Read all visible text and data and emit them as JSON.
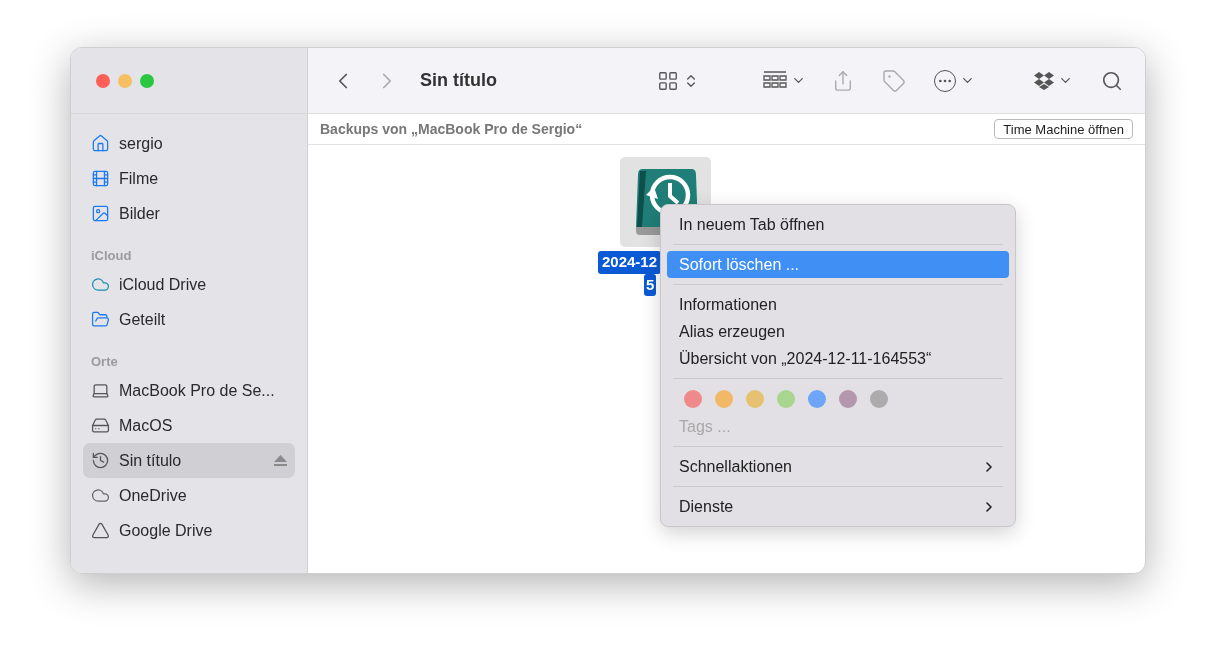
{
  "window": {
    "title": "Sin título"
  },
  "sidebar": {
    "sections": [
      {
        "items": [
          {
            "label": "sergio",
            "kind": "home",
            "selected": false
          },
          {
            "label": "Filme",
            "kind": "film",
            "selected": false
          },
          {
            "label": "Bilder",
            "kind": "photo",
            "selected": false
          }
        ]
      },
      {
        "header": "iCloud",
        "items": [
          {
            "label": "iCloud Drive",
            "kind": "cloud",
            "selected": false
          },
          {
            "label": "Geteilt",
            "kind": "shared",
            "selected": false
          }
        ]
      },
      {
        "header": "Orte",
        "items": [
          {
            "label": "MacBook Pro de Se...",
            "kind": "laptop",
            "selected": false
          },
          {
            "label": "MacOS",
            "kind": "disk",
            "selected": false
          },
          {
            "label": "Sin título",
            "kind": "history",
            "selected": true,
            "eject": true
          },
          {
            "label": "OneDrive",
            "kind": "cloudgray",
            "selected": false
          },
          {
            "label": "Google Drive",
            "kind": "drive",
            "selected": false
          }
        ]
      }
    ]
  },
  "path_bar": {
    "label": "Backups von „MacBook Pro de Sergio“",
    "button": "Time Machine öffnen"
  },
  "file": {
    "name_lines": [
      "2024-12",
      "5"
    ],
    "selected": true
  },
  "context_menu": {
    "groups": [
      [
        {
          "label": "In neuem Tab öffnen",
          "selected": false
        }
      ],
      [
        {
          "label": "Sofort löschen ...",
          "selected": true
        }
      ],
      [
        {
          "label": "Informationen",
          "selected": false
        },
        {
          "label": "Alias erzeugen",
          "selected": false
        },
        {
          "label": "Übersicht von „2024-12-11-164553“",
          "selected": false
        }
      ]
    ],
    "tags": [
      {
        "color": "#f08a8a"
      },
      {
        "color": "#f2b866"
      },
      {
        "color": "#e6c170"
      },
      {
        "color": "#a9d68f"
      },
      {
        "color": "#6ea5f6"
      },
      {
        "color": "#b496ad"
      },
      {
        "color": "#acacac"
      }
    ],
    "tags_label": "Tags ...",
    "submenus": [
      {
        "label": "Schnellaktionen"
      },
      {
        "label": "Dienste"
      }
    ]
  }
}
